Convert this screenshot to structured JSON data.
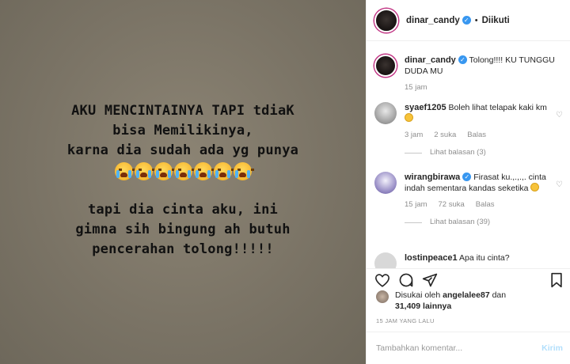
{
  "media": {
    "lines_1": [
      "AKU MENCINTAINYA TAPI tdiaK",
      "bisa Memilikinya,",
      "karna dia sudah ada yg punya"
    ],
    "emoji_count": 7,
    "emoji": "crying-face",
    "lines_2": [
      "tapi dia cinta aku, ini",
      "gimna sih bingung ah butuh",
      "pencerahan tolong!!!!!"
    ]
  },
  "header": {
    "username": "dinar_candy",
    "follow_status": "Diikuti",
    "separator": "•",
    "verified_mark": "✓"
  },
  "caption": {
    "username": "dinar_candy",
    "text": "Tolong!!!! KU TUNGGU DUDA MU",
    "time": "15 jam"
  },
  "comments": [
    {
      "username": "syaef1205",
      "text": "Boleh lihat telapak kaki km",
      "time": "3 jam",
      "likes": "2 suka",
      "reply_label": "Balas",
      "view_replies": "Lihat balasan (3)"
    },
    {
      "username": "wirangbirawa",
      "text": "Firasat ku.,.,.,. cinta indah sementara kandas seketika",
      "time": "15 jam",
      "likes": "72 suka",
      "reply_label": "Balas",
      "view_replies": "Lihat balasan (39)"
    },
    {
      "username": "lostinpeace1",
      "text": "Apa itu cinta?"
    }
  ],
  "likes": {
    "prefix": "Disukai oleh",
    "user": "angelalee87",
    "connector": "dan",
    "count": "31,409 lainnya"
  },
  "timestamp": "15 JAM YANG LALU",
  "comment_input": {
    "placeholder": "Tambahkan komentar...",
    "send_label": "Kirim"
  },
  "colors": {
    "verified": "#3897f0",
    "story_ring": "#c13584",
    "send_disabled": "#b2dffc"
  }
}
